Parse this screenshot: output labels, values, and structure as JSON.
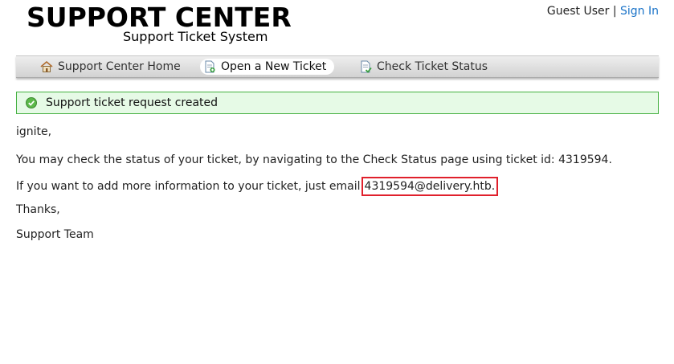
{
  "header": {
    "title": "SUPPORT CENTER",
    "subtitle": "Support Ticket System",
    "guest_label": "Guest User",
    "separator": "|",
    "signin_label": "Sign In"
  },
  "nav": {
    "items": [
      {
        "label": "Support Center Home",
        "icon": "home-icon"
      },
      {
        "label": "Open a New Ticket",
        "icon": "new-ticket-icon",
        "active": true
      },
      {
        "label": "Check Ticket Status",
        "icon": "ticket-status-icon"
      }
    ]
  },
  "notice": {
    "message": "Support ticket request created",
    "icon": "checkmark-icon",
    "color": "#44b040"
  },
  "body": {
    "greeting": "ignite,",
    "status_line": "You may check the status of your ticket, by navigating to the Check Status page using ticket id: 4319594.",
    "email_prefix": "If you want to add more information to your ticket, just email",
    "email": "4319594@delivery.htb.",
    "thanks": "Thanks,",
    "signature": "Support Team"
  }
}
